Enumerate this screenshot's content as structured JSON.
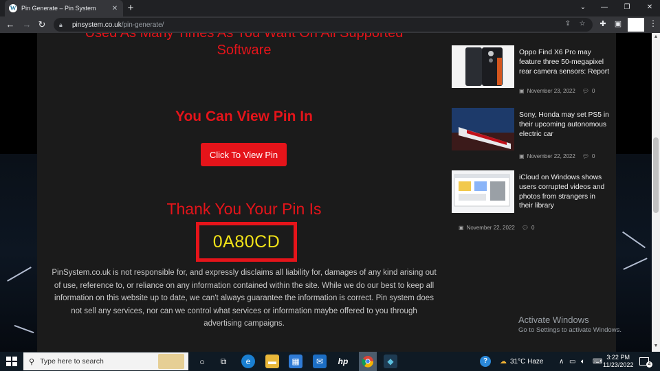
{
  "browser": {
    "tab_title": "Pin Generate – Pin System",
    "tab_close": "✕",
    "new_tab": "+",
    "url_domain": "pinsystem.co.uk",
    "url_path": "/pin-generate/",
    "window_controls": {
      "minimize": "—",
      "restore": "❐",
      "close": "✕",
      "tabs_menu": "⌄"
    }
  },
  "page": {
    "cut_heading": "Used As Many Times As You Want On All Supported",
    "software": "Software",
    "view_pin_in": "You Can View Pin In",
    "view_button": "Click To View Pin",
    "thanks": "Thank You Your Pin Is",
    "pin": "0A80CD",
    "disclaimer": "PinSystem.co.uk is not responsible for, and expressly disclaims all liability for, damages of any kind arising out of use, reference to, or reliance on any information contained within the site. While we do our best to keep all information on this website up to date, we can't always guarantee the information is correct. Pin system does not sell any services, nor can we control what services or information maybe offered to you through advertising campaigns."
  },
  "sidebar": {
    "news": [
      {
        "title": "Oppo Find X6 Pro may feature three 50-megapixel rear camera sensors: Report",
        "date": "November 23, 2022",
        "comments": "0"
      },
      {
        "title": "Sony, Honda may set PS5 in their upcoming autonomous electric car",
        "date": "November 22, 2022",
        "comments": "0"
      },
      {
        "title": "iCloud on Windows shows users corrupted videos and photos from strangers in their library",
        "date": "November 22, 2022",
        "comments": "0"
      }
    ]
  },
  "watermark": {
    "title": "Activate Windows",
    "subtitle": "Go to Settings to activate Windows."
  },
  "taskbar": {
    "search_placeholder": "Type here to search",
    "weather": "31°C  Haze",
    "time": "3:22 PM",
    "date": "11/23/2022",
    "notification_count": "4"
  },
  "colors": {
    "accent_red": "#e5141a",
    "pin_yellow": "#f2e318",
    "content_bg": "#1b1b1b"
  }
}
